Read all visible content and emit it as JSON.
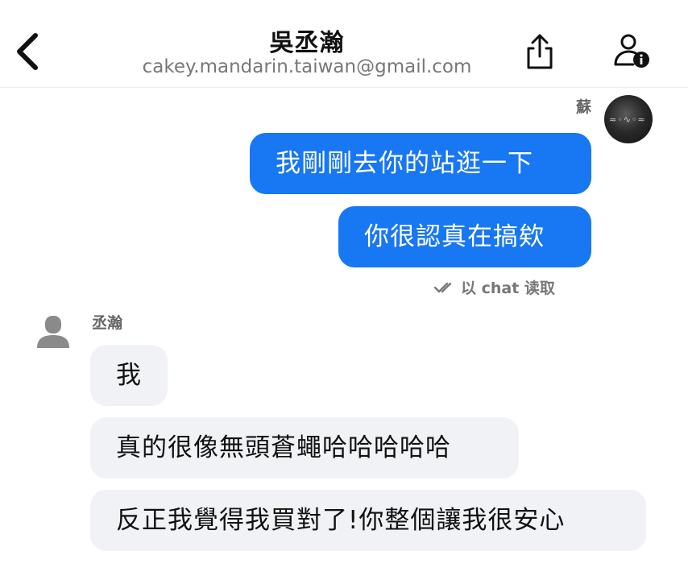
{
  "header": {
    "title": "吳丞瀚",
    "subtitle": "cakey.mandarin.taiwan@gmail.com",
    "icons": [
      "back-icon",
      "share-icon",
      "contact-info-icon"
    ]
  },
  "messages": {
    "outgoing_sender": "蘇",
    "outgoing": [
      {
        "text": "我剛剛去你的站逛一下"
      },
      {
        "text": "你很認真在搞欸"
      }
    ],
    "read_receipt": "以 chat 读取",
    "incoming_sender": "丞瀚",
    "incoming": [
      {
        "text": "我"
      },
      {
        "text": "真的很像無頭蒼蠅哈哈哈哈哈"
      },
      {
        "text": "反正我覺得我買對了!你整個讓我很安心"
      }
    ]
  },
  "colors": {
    "outgoing_bubble": "#1877f2",
    "incoming_bubble": "#f0f2f5",
    "secondary_text": "#777777"
  }
}
